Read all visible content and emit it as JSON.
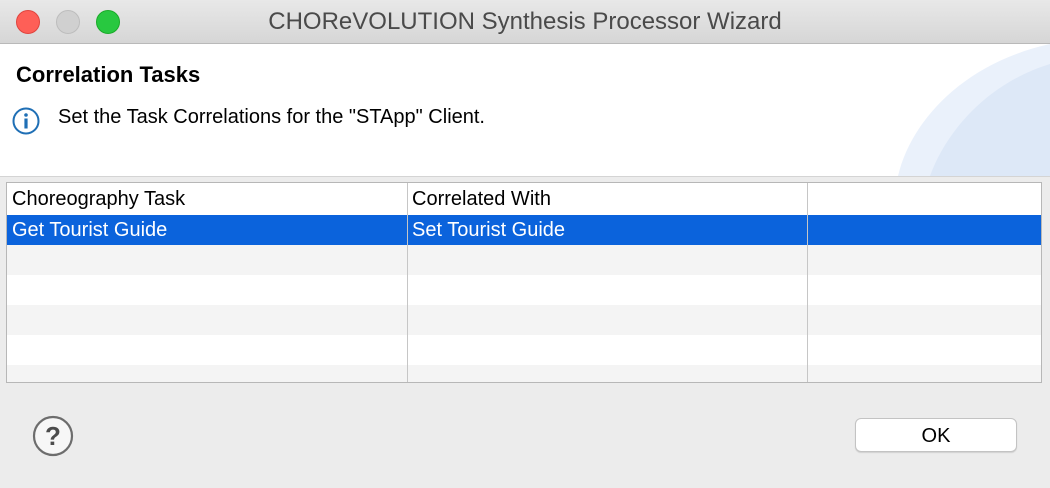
{
  "window": {
    "title": "CHOReVOLUTION Synthesis Processor Wizard",
    "controls": [
      "close-icon",
      "minimize-icon",
      "maximize-icon"
    ]
  },
  "header": {
    "title": "Correlation Tasks",
    "message": "Set the Task Correlations for the \"STApp\" Client.",
    "message_icon": "info-icon"
  },
  "table": {
    "columns": [
      "Choreography Task",
      "Correlated With",
      ""
    ],
    "rows": [
      {
        "task": "Get Tourist Guide",
        "correlated_with": "Set Tourist Guide",
        "selected": true
      }
    ]
  },
  "footer": {
    "help_icon": "help-icon",
    "ok_label": "OK"
  },
  "colors": {
    "selection": "#0b63dc",
    "close": "#fe5f57",
    "maximize": "#28c840",
    "info_icon": "#1f6fb5"
  }
}
